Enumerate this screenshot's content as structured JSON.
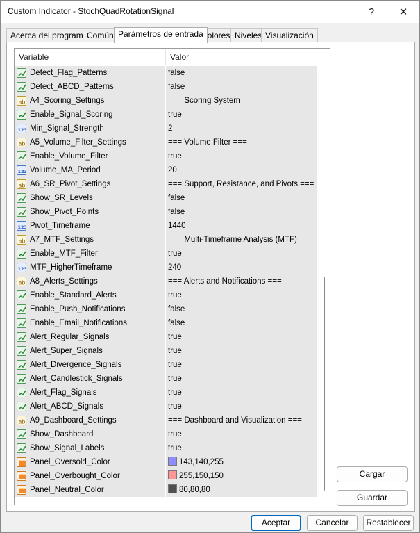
{
  "window": {
    "title": "Custom Indicator - StochQuadRotationSignal",
    "help": "?",
    "close": "✕"
  },
  "tabs": [
    {
      "label": "Acerca del programa"
    },
    {
      "label": "Común"
    },
    {
      "label": "Parámetros de entrada"
    },
    {
      "label": "Colores"
    },
    {
      "label": "Niveles"
    },
    {
      "label": "Visualización"
    }
  ],
  "active_tab": "Parámetros de entrada",
  "grid": {
    "columns": {
      "variable": "Variable",
      "value": "Valor"
    },
    "rows": [
      {
        "type": "bool",
        "name": "Detect_Flag_Patterns",
        "value": "false"
      },
      {
        "type": "bool",
        "name": "Detect_ABCD_Patterns",
        "value": "false"
      },
      {
        "type": "text",
        "name": "A4_Scoring_Settings",
        "value": "=== Scoring System ==="
      },
      {
        "type": "bool",
        "name": "Enable_Signal_Scoring",
        "value": "true"
      },
      {
        "type": "num",
        "name": "Min_Signal_Strength",
        "value": "2"
      },
      {
        "type": "text",
        "name": "A5_Volume_Filter_Settings",
        "value": "=== Volume Filter ==="
      },
      {
        "type": "bool",
        "name": "Enable_Volume_Filter",
        "value": "true"
      },
      {
        "type": "num",
        "name": "Volume_MA_Period",
        "value": "20"
      },
      {
        "type": "text",
        "name": "A6_SR_Pivot_Settings",
        "value": "=== Support, Resistance, and Pivots ==="
      },
      {
        "type": "bool",
        "name": "Show_SR_Levels",
        "value": "false"
      },
      {
        "type": "bool",
        "name": "Show_Pivot_Points",
        "value": "false"
      },
      {
        "type": "num",
        "name": "Pivot_Timeframe",
        "value": "1440"
      },
      {
        "type": "text",
        "name": "A7_MTF_Settings",
        "value": "=== Multi-Timeframe Analysis (MTF) ==="
      },
      {
        "type": "bool",
        "name": "Enable_MTF_Filter",
        "value": "true"
      },
      {
        "type": "num",
        "name": "MTF_HigherTimeframe",
        "value": "240"
      },
      {
        "type": "text",
        "name": "A8_Alerts_Settings",
        "value": "=== Alerts and Notifications ==="
      },
      {
        "type": "bool",
        "name": "Enable_Standard_Alerts",
        "value": "true"
      },
      {
        "type": "bool",
        "name": "Enable_Push_Notifications",
        "value": "false"
      },
      {
        "type": "bool",
        "name": "Enable_Email_Notifications",
        "value": "false"
      },
      {
        "type": "bool",
        "name": "Alert_Regular_Signals",
        "value": "true"
      },
      {
        "type": "bool",
        "name": "Alert_Super_Signals",
        "value": "true"
      },
      {
        "type": "bool",
        "name": "Alert_Divergence_Signals",
        "value": "true"
      },
      {
        "type": "bool",
        "name": "Alert_Candlestick_Signals",
        "value": "true"
      },
      {
        "type": "bool",
        "name": "Alert_Flag_Signals",
        "value": "true"
      },
      {
        "type": "bool",
        "name": "Alert_ABCD_Signals",
        "value": "true"
      },
      {
        "type": "text",
        "name": "A9_Dashboard_Settings",
        "value": "=== Dashboard and Visualization ==="
      },
      {
        "type": "bool",
        "name": "Show_Dashboard",
        "value": "true"
      },
      {
        "type": "bool",
        "name": "Show_Signal_Labels",
        "value": "true"
      },
      {
        "type": "color",
        "name": "Panel_Oversold_Color",
        "value": "143,140,255",
        "swatch": "#8f8cff"
      },
      {
        "type": "color",
        "name": "Panel_Overbought_Color",
        "value": "255,150,150",
        "swatch": "#ff9696"
      },
      {
        "type": "color",
        "name": "Panel_Neutral_Color",
        "value": "80,80,80",
        "swatch": "#505050"
      }
    ]
  },
  "side_buttons": {
    "load": "Cargar",
    "save": "Guardar"
  },
  "footer_buttons": {
    "ok": "Aceptar",
    "cancel": "Cancelar",
    "reset": "Restablecer"
  },
  "colors": {
    "accent": "#0067c0",
    "row_bg": "#e7e7e7"
  }
}
